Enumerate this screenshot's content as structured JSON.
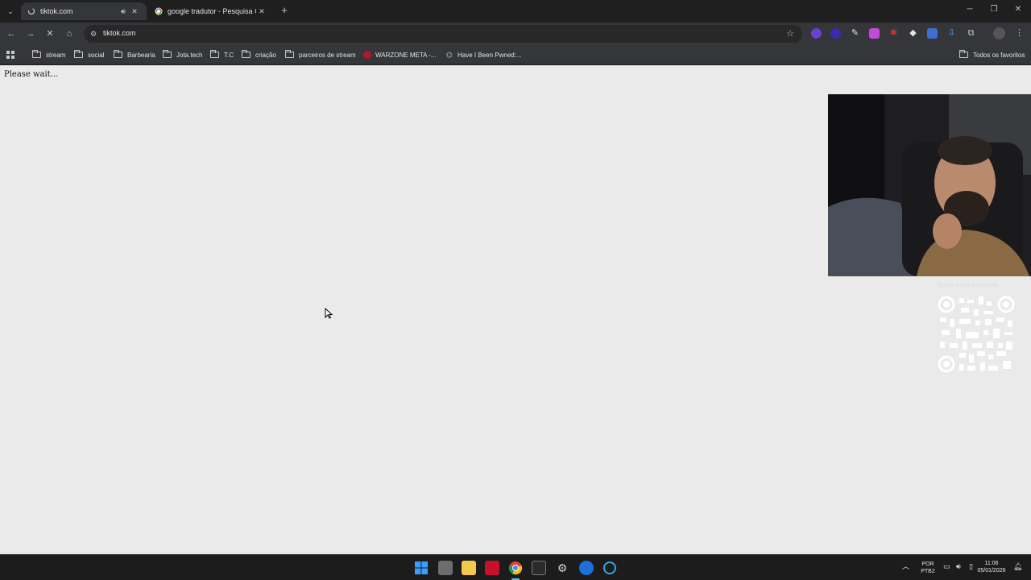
{
  "browser": {
    "tabs": [
      {
        "title": "tiktok.com",
        "active": true
      },
      {
        "title": "google tradutor - Pesquisa Goo",
        "active": false
      }
    ],
    "address_url": "tiktok.com",
    "bookmarks": [
      {
        "label": "stream",
        "type": "folder"
      },
      {
        "label": "social",
        "type": "folder"
      },
      {
        "label": "Barbearia",
        "type": "folder"
      },
      {
        "label": "Jota.tech",
        "type": "folder"
      },
      {
        "label": "T.C",
        "type": "folder"
      },
      {
        "label": "criação",
        "type": "folder"
      },
      {
        "label": "parceiros de stream",
        "type": "folder"
      },
      {
        "label": "WARZONE META -...",
        "type": "link"
      },
      {
        "label": "Have I Been Pwned:...",
        "type": "link"
      }
    ],
    "all_bookmarks_label": "Todos os favoritos"
  },
  "page": {
    "message": "Please wait..."
  },
  "overlay": {
    "qr_caption": "Apoie a live escaneie"
  },
  "taskbar": {
    "language_line1": "POR",
    "language_line2": "PTB2",
    "time": "11:06",
    "date": "05/01/2026"
  },
  "colors": {
    "chrome_dark": "#1f1f1f",
    "toolbar": "#35363a",
    "page_bg": "#eaeaea",
    "taskbar": "#1c1c1c"
  }
}
